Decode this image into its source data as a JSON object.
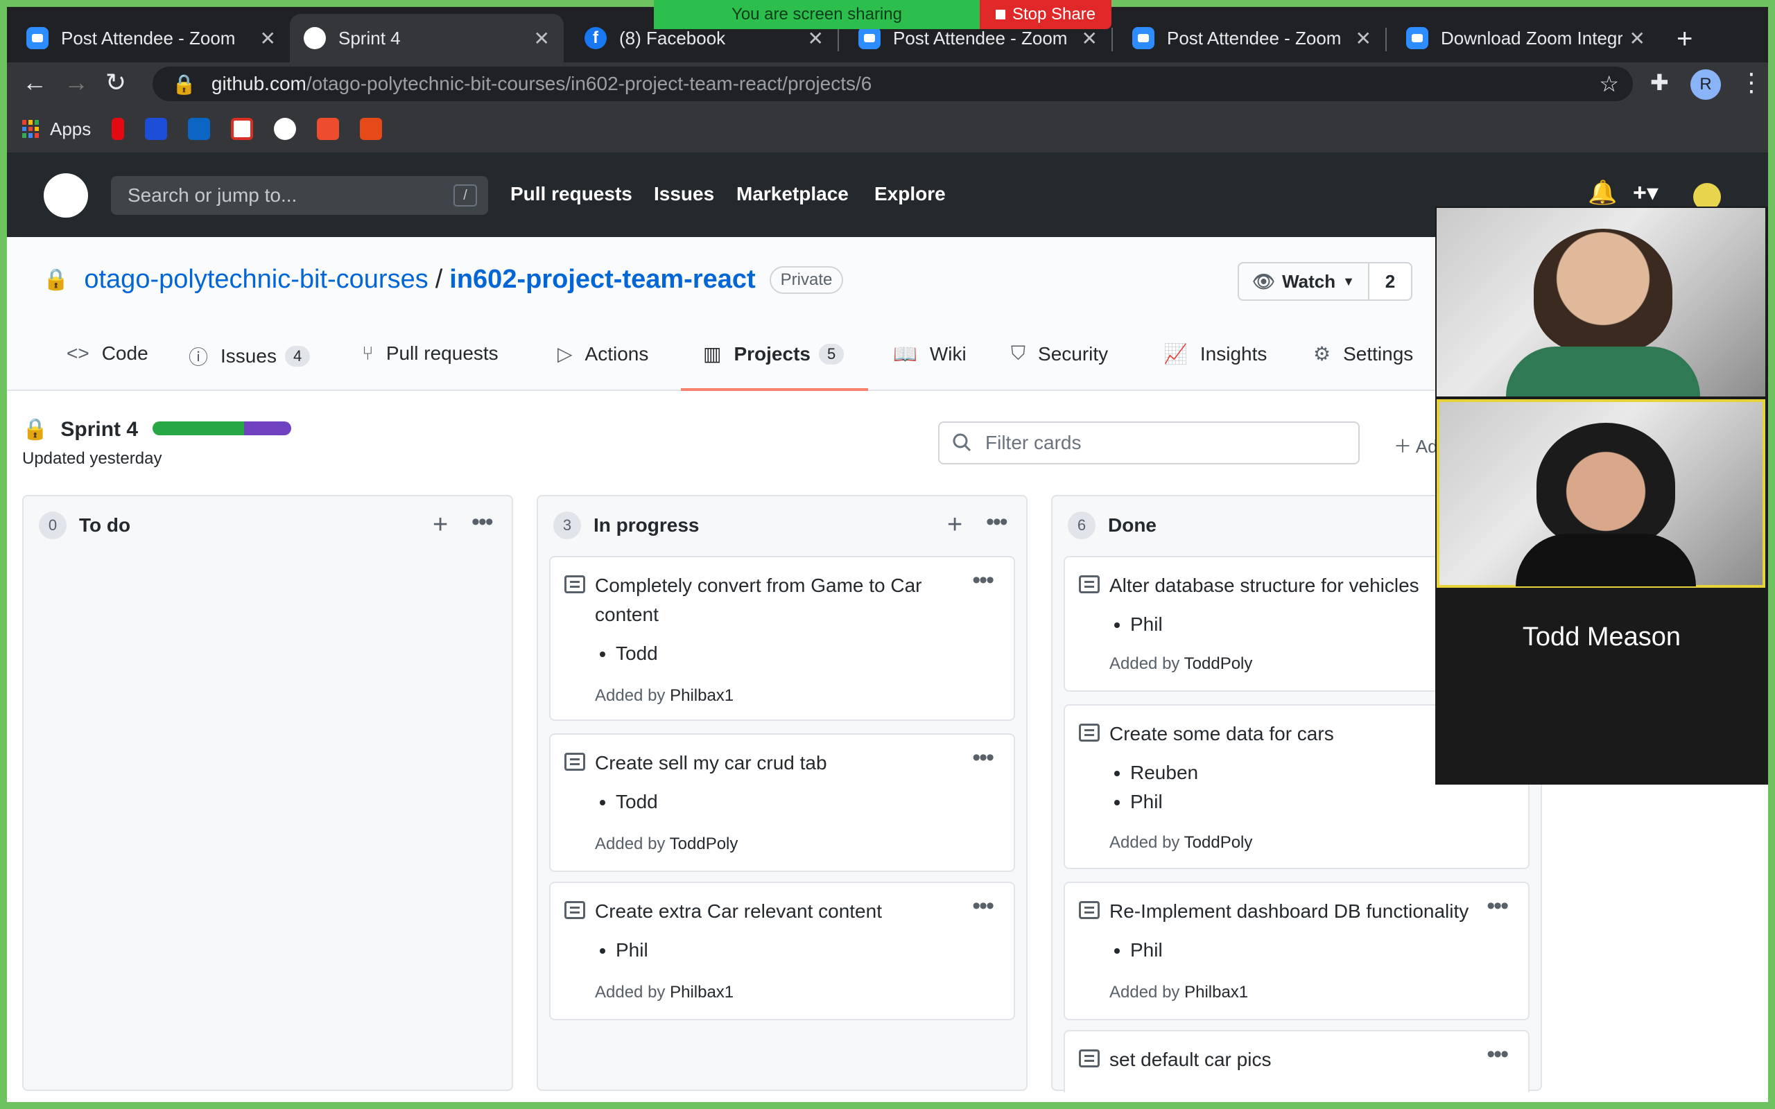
{
  "browser": {
    "tabs": [
      {
        "title": "Post Attendee - Zoom",
        "icon": "zoom-icon"
      },
      {
        "title": "Sprint 4",
        "icon": "github-icon"
      },
      {
        "title": "(8) Facebook",
        "icon": "facebook-icon"
      },
      {
        "title": "Post Attendee - Zoom",
        "icon": "zoom-icon"
      },
      {
        "title": "Post Attendee - Zoom",
        "icon": "zoom-icon"
      },
      {
        "title": "Download Zoom Integra",
        "icon": "zoom-icon"
      }
    ],
    "url_host": "github.com",
    "url_path": "/otago-polytechnic-bit-courses/in602-project-team-react/projects/6",
    "bookmarks": {
      "apps_label": "Apps"
    },
    "profile_initial": "R"
  },
  "share_banner": {
    "status": "You are screen sharing",
    "stop_label": "Stop Share"
  },
  "github_header": {
    "search_placeholder": "Search or jump to...",
    "search_key": "/",
    "nav": [
      "Pull requests",
      "Issues",
      "Marketplace",
      "Explore"
    ]
  },
  "repo": {
    "owner": "otago-polytechnic-bit-courses",
    "separator": "/",
    "name": "in602-project-team-react",
    "visibility": "Private",
    "watch_label": "Watch",
    "watch_count": "2",
    "tabs": [
      {
        "label": "Code",
        "icon": "code-icon"
      },
      {
        "label": "Issues",
        "icon": "issue-icon",
        "count": "4"
      },
      {
        "label": "Pull requests",
        "icon": "pull-request-icon"
      },
      {
        "label": "Actions",
        "icon": "play-icon"
      },
      {
        "label": "Projects",
        "icon": "project-icon",
        "count": "5"
      },
      {
        "label": "Wiki",
        "icon": "book-icon"
      },
      {
        "label": "Security",
        "icon": "shield-icon"
      },
      {
        "label": "Insights",
        "icon": "graph-icon"
      },
      {
        "label": "Settings",
        "icon": "gear-icon"
      }
    ]
  },
  "project": {
    "title": "Sprint 4",
    "updated": "Updated yesterday",
    "filter_placeholder": "Filter cards",
    "add_label": "Ad",
    "progress": {
      "done_fraction": 0.66,
      "in_progress_fraction": 0.34
    },
    "columns": [
      {
        "name": "To do",
        "count": "0",
        "cards": []
      },
      {
        "name": "In progress",
        "count": "3",
        "cards": [
          {
            "title": "Completely convert from Game to Car content",
            "assignees": [
              "Todd"
            ],
            "added_by_prefix": "Added by",
            "added_by": "Philbax1"
          },
          {
            "title": "Create sell my car crud tab",
            "assignees": [
              "Todd"
            ],
            "added_by_prefix": "Added by",
            "added_by": "ToddPoly"
          },
          {
            "title": "Create extra Car relevant content",
            "assignees": [
              "Phil"
            ],
            "added_by_prefix": "Added by",
            "added_by": "Philbax1"
          }
        ]
      },
      {
        "name": "Done",
        "count": "6",
        "cards": [
          {
            "title": "Alter database structure for vehicles",
            "assignees": [
              "Phil"
            ],
            "added_by_prefix": "Added by",
            "added_by": "ToddPoly"
          },
          {
            "title": "Create some data for cars",
            "assignees": [
              "Reuben",
              "Phil"
            ],
            "added_by_prefix": "Added by",
            "added_by": "ToddPoly"
          },
          {
            "title": "Re-Implement dashboard DB functionality",
            "assignees": [
              "Phil"
            ],
            "added_by_prefix": "Added by",
            "added_by": "Philbax1"
          },
          {
            "title": "set default car pics",
            "assignees": [],
            "added_by_prefix": "",
            "added_by": ""
          }
        ]
      }
    ]
  },
  "zoom": {
    "participant_name": "Todd Meason"
  },
  "colors": {
    "accent": "#0366d6",
    "header": "#24292e",
    "share_green": "#6ec25f",
    "tab_underline": "#f9826c",
    "progress_done": "#28a745",
    "progress_in_progress": "#6f42c1"
  }
}
